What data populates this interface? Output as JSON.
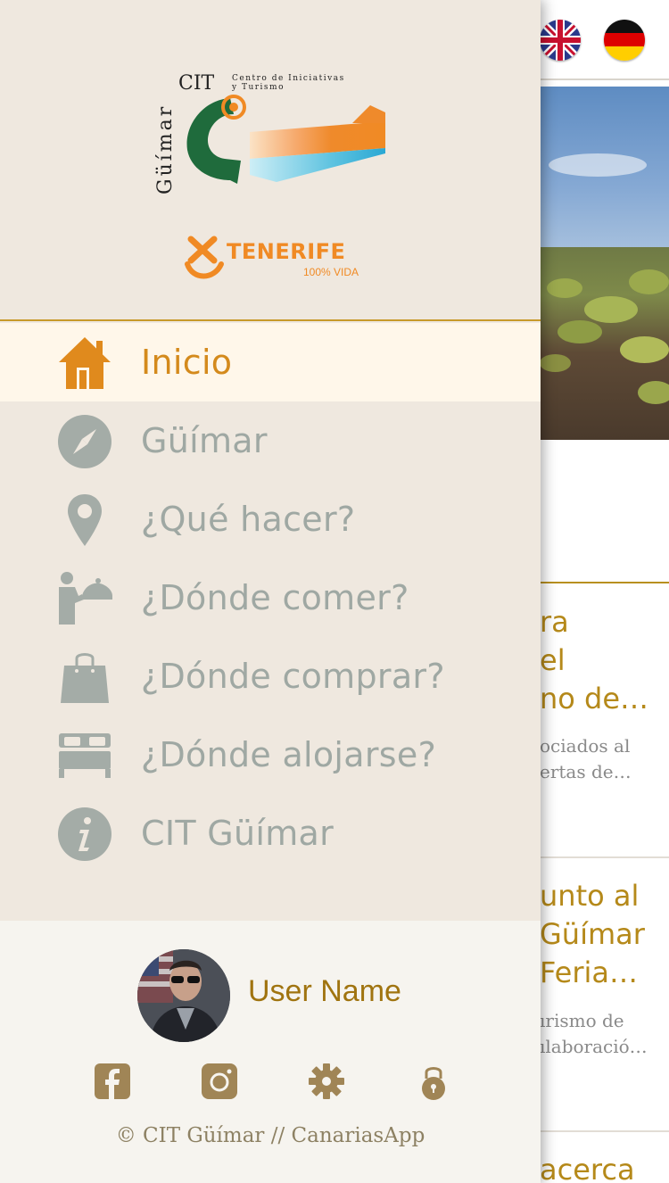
{
  "colors": {
    "accent_gold": "#b5891a",
    "active_orange": "#d48a1c",
    "menu_grey": "#9fa8a3",
    "drawer_bg": "#efe8df",
    "active_bg": "#fff7ea",
    "footer_bg": "#f6f4ef",
    "footer_icon_brown": "#a08556",
    "tenerife_orange": "#f08a24",
    "cit_green": "#1f6b3c"
  },
  "background": {
    "languages": [
      {
        "name": "english-flag-icon"
      },
      {
        "name": "german-flag-icon"
      }
    ],
    "cards": [
      {
        "title": "ra\nel\nno de…",
        "text": "ociados al\nertas de…"
      },
      {
        "title": "unto al\nGüímar\nFeria…",
        "text": "ırismo de\nılaboració…"
      },
      {
        "title": "acerca",
        "text": ""
      }
    ]
  },
  "drawer": {
    "logos": {
      "cit_brand": "CIT",
      "cit_subtitle_1": "Centro de Iniciativas",
      "cit_subtitle_2": "y Turismo",
      "cit_vertical": "Güímar",
      "tenerife": "TENERIFE",
      "tenerife_tagline": "100% VIDA"
    },
    "menu": [
      {
        "label": "Inicio",
        "icon": "home-icon",
        "active": true
      },
      {
        "label": "Güímar",
        "icon": "compass-icon",
        "active": false
      },
      {
        "label": "¿Qué hacer?",
        "icon": "location-pin-icon",
        "active": false
      },
      {
        "label": "¿Dónde comer?",
        "icon": "waiter-icon",
        "active": false
      },
      {
        "label": "¿Dónde comprar?",
        "icon": "shopping-bag-icon",
        "active": false
      },
      {
        "label": "¿Dónde alojarse?",
        "icon": "bed-icon",
        "active": false
      },
      {
        "label": "CIT Güímar",
        "icon": "info-icon",
        "active": false
      }
    ],
    "user": {
      "name": "User Name"
    },
    "footer_icons": [
      "facebook-icon",
      "instagram-icon",
      "settings-icon",
      "lock-icon"
    ],
    "copyright": "© CIT Güímar // CanariasApp"
  }
}
